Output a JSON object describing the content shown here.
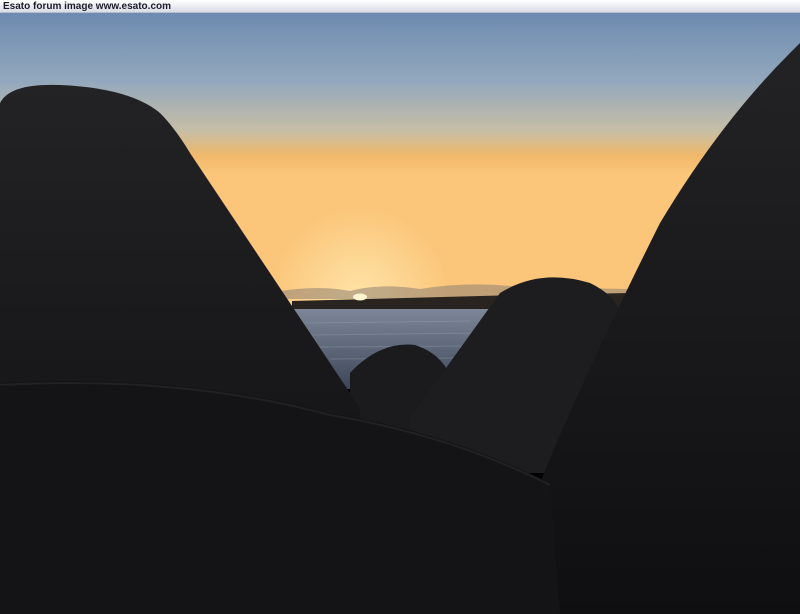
{
  "header": {
    "caption": "Esato forum image www.esato.com"
  },
  "photo": {
    "subject": "sunset-over-sea-between-breakwater-blocks",
    "colors": {
      "sky_top": "#6e8db2",
      "sky_mid": "#c9b7a0",
      "sky_glow": "#f6b85a",
      "horizon": "#fbd083",
      "sun": "#fff4cf",
      "sea": "#5d6f85",
      "silhouette": "#141416"
    }
  }
}
